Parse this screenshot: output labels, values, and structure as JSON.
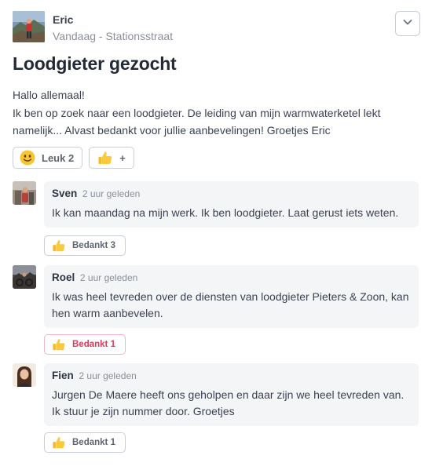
{
  "post": {
    "author": "Eric",
    "meta": "Vandaag - Stationsstraat",
    "title": "Loodgieter gezocht",
    "body_lines": [
      "Hallo allemaal!",
      "Ik ben op zoek naar een loodgieter. De leiding van mijn warmwaterketel lekt",
      "namelijk... Alvast bedankt voor jullie aanbevelingen! Groetjes Eric"
    ],
    "reactions": {
      "like_label": "Leuk 2",
      "add_label": "+"
    }
  },
  "comments": [
    {
      "name": "Sven",
      "time": "2 uur geleden",
      "text": "Ik kan maandag na mijn werk. Ik ben loodgieter. Laat gerust iets weten.",
      "thanks_label": "Bedankt 3",
      "thanked": false
    },
    {
      "name": "Roel",
      "time": "2 uur geleden",
      "text": "Ik was heel tevreden over de diensten van loodgieter Pieters & Zoon, kan hen warm aanbevelen.",
      "thanks_label": "Bedankt 1",
      "thanked": true
    },
    {
      "name": "Fien",
      "time": "2 uur geleden",
      "text": "Jurgen De Maere heeft ons geholpen en daar zijn we heel tevreden van. Ik stuur je zijn nummer door. Groetjes",
      "thanks_label": "Bedankt 1",
      "thanked": false
    }
  ],
  "colors": {
    "accent_thanked": "#e0395c",
    "bubble_bg": "#f4f5f7",
    "border": "#c9ced6"
  },
  "icons": {
    "menu": "chevron-down-icon",
    "like": "smiley-icon",
    "thumbs": "thumbs-up-icon"
  }
}
